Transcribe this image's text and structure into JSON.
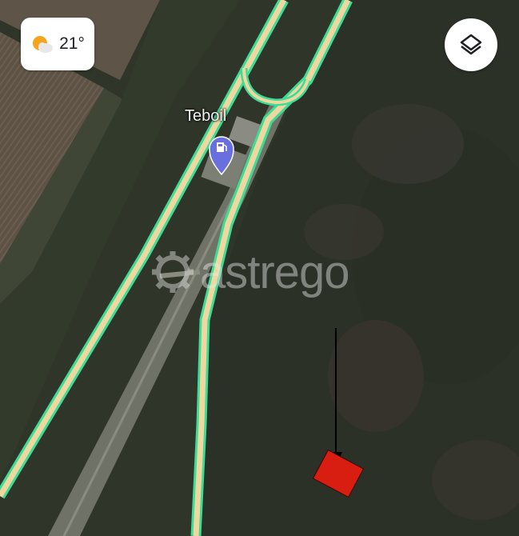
{
  "weather": {
    "temperature": "21°",
    "icon": "partly-sunny-icon"
  },
  "layers_button": {
    "icon": "layers-icon"
  },
  "poi": {
    "name": "Teboil",
    "icon": "gas-station-pin-icon"
  },
  "watermark": {
    "text": "astrego"
  },
  "marker": {
    "icon": "red-square-marker",
    "color": "#d81e10"
  },
  "colors": {
    "road_outline": "#3ddc97",
    "road_fill": "#efd8a0",
    "pin": "#6a6fe0"
  }
}
